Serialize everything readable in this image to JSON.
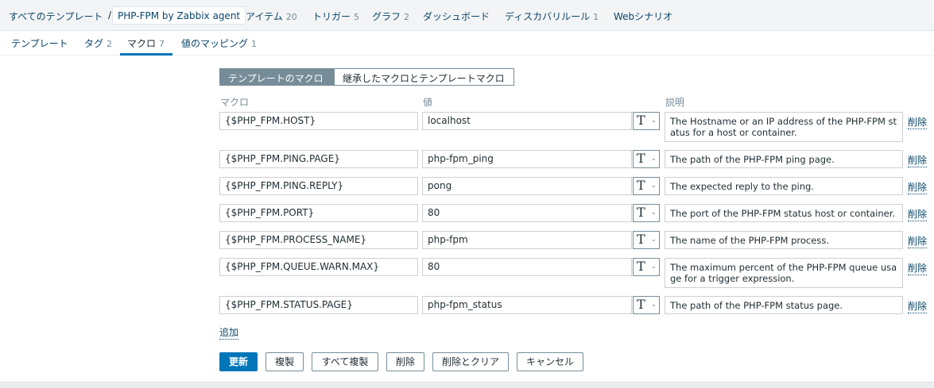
{
  "breadcrumb": {
    "all_templates": "すべてのテンプレート",
    "separator": "/",
    "current": "PHP-FPM by Zabbix agent",
    "items": [
      {
        "label": "アイテム",
        "count": "20"
      },
      {
        "label": "トリガー",
        "count": "5"
      },
      {
        "label": "グラフ",
        "count": "2"
      },
      {
        "label": "ダッシュボード",
        "count": ""
      },
      {
        "label": "ディスカバリルール",
        "count": "1"
      },
      {
        "label": "Webシナリオ",
        "count": ""
      }
    ]
  },
  "tabs": [
    {
      "label": "テンプレート",
      "count": ""
    },
    {
      "label": "タグ",
      "count": "2"
    },
    {
      "label": "マクロ",
      "count": "7",
      "active": true
    },
    {
      "label": "値のマッピング",
      "count": "1"
    }
  ],
  "segment": {
    "template_macros": "テンプレートのマクロ",
    "inherited_macros": "継承したマクロとテンプレートマクロ"
  },
  "columns": {
    "macro": "マクロ",
    "value": "値",
    "description": "説明"
  },
  "macros": [
    {
      "macro": "{$PHP_FPM.HOST}",
      "value": "localhost",
      "type": "T",
      "description": "The Hostname or an IP address of the PHP-FPM status for a host or container."
    },
    {
      "macro": "{$PHP_FPM.PING.PAGE}",
      "value": "php-fpm_ping",
      "type": "T",
      "description": "The path of the PHP-FPM ping page."
    },
    {
      "macro": "{$PHP_FPM.PING.REPLY}",
      "value": "pong",
      "type": "T",
      "description": "The expected reply to the ping."
    },
    {
      "macro": "{$PHP_FPM.PORT}",
      "value": "80",
      "type": "T",
      "description": "The port of the PHP-FPM status host or container."
    },
    {
      "macro": "{$PHP_FPM.PROCESS_NAME}",
      "value": "php-fpm",
      "type": "T",
      "description": "The name of the PHP-FPM process."
    },
    {
      "macro": "{$PHP_FPM.QUEUE.WARN.MAX}",
      "value": "80",
      "type": "T",
      "description": "The maximum percent of the PHP-FPM queue usage for a trigger expression."
    },
    {
      "macro": "{$PHP_FPM.STATUS.PAGE}",
      "value": "php-fpm_status",
      "type": "T",
      "description": "The path of the PHP-FPM status page."
    }
  ],
  "row_remove_label": "削除",
  "add_label": "追加",
  "buttons": {
    "update": "更新",
    "clone": "複製",
    "full_clone": "すべて複製",
    "delete": "削除",
    "delete_clear": "削除とクリア",
    "cancel": "キャンセル"
  }
}
